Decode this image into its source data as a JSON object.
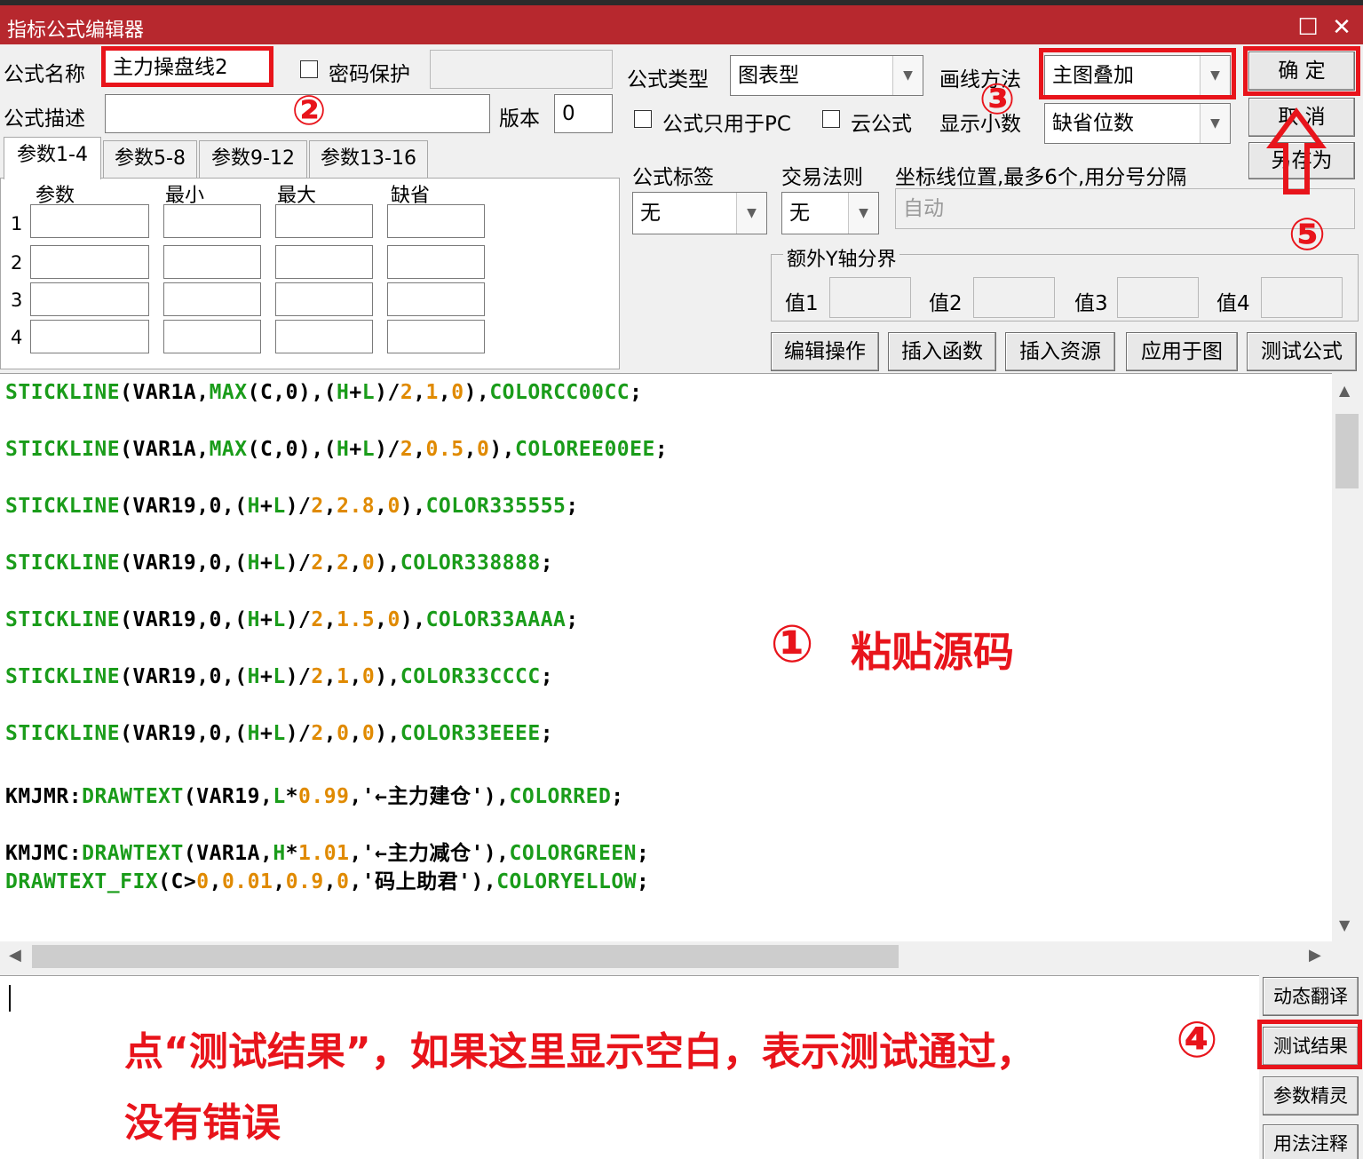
{
  "window": {
    "title": "指标公式编辑器",
    "maximize_glyph": "☐",
    "close_glyph": "✕"
  },
  "form": {
    "name_label": "公式名称",
    "name_value": "主力操盘线2",
    "password_label": "密码保护",
    "desc_label": "公式描述",
    "version_label": "版本",
    "version_value": "0",
    "type_label": "公式类型",
    "type_value": "图表型",
    "draw_label": "画线方法",
    "draw_value": "主图叠加",
    "pc_only_label": "公式只用于PC",
    "cloud_label": "云公式",
    "decimal_label": "显示小数",
    "decimal_value": "缺省位数",
    "tag_label": "公式标签",
    "tag_value": "无",
    "trade_label": "交易法则",
    "trade_value": "无",
    "coord_label": "坐标线位置,最多6个,用分号分隔",
    "coord_value": "自动",
    "yaxis_group": "额外Y轴分界",
    "yvals": [
      "值1",
      "值2",
      "值3",
      "值4"
    ]
  },
  "buttons": {
    "ok": "确  定",
    "cancel": "取  消",
    "save_as": "另存为",
    "edit_ops": "编辑操作",
    "insert_func": "插入函数",
    "insert_res": "插入资源",
    "apply": "应用于图",
    "test": "测试公式",
    "dyn_translate": "动态翻译",
    "test_result": "测试结果",
    "param_wizard": "参数精灵",
    "usage_note": "用法注释"
  },
  "tabs": [
    "参数1-4",
    "参数5-8",
    "参数9-12",
    "参数13-16"
  ],
  "params": {
    "headers": [
      "参数",
      "最小",
      "最大",
      "缺省"
    ],
    "rows": [
      "1",
      "2",
      "3",
      "4"
    ]
  },
  "code": [
    [
      [
        "STICKLINE",
        "g"
      ],
      [
        "(VAR1A,",
        "k"
      ],
      [
        "MAX",
        "g"
      ],
      [
        "(C,0),(",
        "k"
      ],
      [
        "H",
        "g"
      ],
      [
        "+",
        "k"
      ],
      [
        "L",
        "g"
      ],
      [
        ")/",
        "k"
      ],
      [
        "2",
        "o"
      ],
      [
        ",",
        "k"
      ],
      [
        "1",
        "o"
      ],
      [
        ",",
        "k"
      ],
      [
        "0",
        "o"
      ],
      [
        "),",
        "k"
      ],
      [
        "COLORCC00CC",
        "g"
      ],
      [
        ";",
        "k"
      ]
    ],
    [
      [
        "STICKLINE",
        "g"
      ],
      [
        "(VAR1A,",
        "k"
      ],
      [
        "MAX",
        "g"
      ],
      [
        "(C,0),(",
        "k"
      ],
      [
        "H",
        "g"
      ],
      [
        "+",
        "k"
      ],
      [
        "L",
        "g"
      ],
      [
        ")/",
        "k"
      ],
      [
        "2",
        "o"
      ],
      [
        ",",
        "k"
      ],
      [
        "0.5",
        "o"
      ],
      [
        ",",
        "k"
      ],
      [
        "0",
        "o"
      ],
      [
        "),",
        "k"
      ],
      [
        "COLOREE00EE",
        "g"
      ],
      [
        ";",
        "k"
      ]
    ],
    [
      [
        "STICKLINE",
        "g"
      ],
      [
        "(VAR19,0,(",
        "k"
      ],
      [
        "H",
        "g"
      ],
      [
        "+",
        "k"
      ],
      [
        "L",
        "g"
      ],
      [
        ")/",
        "k"
      ],
      [
        "2",
        "o"
      ],
      [
        ",",
        "k"
      ],
      [
        "2.8",
        "o"
      ],
      [
        ",",
        "k"
      ],
      [
        "0",
        "o"
      ],
      [
        "),",
        "k"
      ],
      [
        "COLOR335555",
        "g"
      ],
      [
        ";",
        "k"
      ]
    ],
    [
      [
        "STICKLINE",
        "g"
      ],
      [
        "(VAR19,0,(",
        "k"
      ],
      [
        "H",
        "g"
      ],
      [
        "+",
        "k"
      ],
      [
        "L",
        "g"
      ],
      [
        ")/",
        "k"
      ],
      [
        "2",
        "o"
      ],
      [
        ",",
        "k"
      ],
      [
        "2",
        "o"
      ],
      [
        ",",
        "k"
      ],
      [
        "0",
        "o"
      ],
      [
        "),",
        "k"
      ],
      [
        "COLOR338888",
        "g"
      ],
      [
        ";",
        "k"
      ]
    ],
    [
      [
        "STICKLINE",
        "g"
      ],
      [
        "(VAR19,0,(",
        "k"
      ],
      [
        "H",
        "g"
      ],
      [
        "+",
        "k"
      ],
      [
        "L",
        "g"
      ],
      [
        ")/",
        "k"
      ],
      [
        "2",
        "o"
      ],
      [
        ",",
        "k"
      ],
      [
        "1.5",
        "o"
      ],
      [
        ",",
        "k"
      ],
      [
        "0",
        "o"
      ],
      [
        "),",
        "k"
      ],
      [
        "COLOR33AAAA",
        "g"
      ],
      [
        ";",
        "k"
      ]
    ],
    [
      [
        "STICKLINE",
        "g"
      ],
      [
        "(VAR19,0,(",
        "k"
      ],
      [
        "H",
        "g"
      ],
      [
        "+",
        "k"
      ],
      [
        "L",
        "g"
      ],
      [
        ")/",
        "k"
      ],
      [
        "2",
        "o"
      ],
      [
        ",",
        "k"
      ],
      [
        "1",
        "o"
      ],
      [
        ",",
        "k"
      ],
      [
        "0",
        "o"
      ],
      [
        "),",
        "k"
      ],
      [
        "COLOR33CCCC",
        "g"
      ],
      [
        ";",
        "k"
      ]
    ],
    [
      [
        "STICKLINE",
        "g"
      ],
      [
        "(VAR19,0,(",
        "k"
      ],
      [
        "H",
        "g"
      ],
      [
        "+",
        "k"
      ],
      [
        "L",
        "g"
      ],
      [
        ")/",
        "k"
      ],
      [
        "2",
        "o"
      ],
      [
        ",",
        "k"
      ],
      [
        "0",
        "o"
      ],
      [
        ",",
        "k"
      ],
      [
        "0",
        "o"
      ],
      [
        "),",
        "k"
      ],
      [
        "COLOR33EEEE",
        "g"
      ],
      [
        ";",
        "k"
      ]
    ],
    [
      [
        "KMJMR:",
        "k"
      ],
      [
        "DRAWTEXT",
        "g"
      ],
      [
        "(VAR19,",
        "k"
      ],
      [
        "L",
        "g"
      ],
      [
        "*",
        "k"
      ],
      [
        "0.99",
        "o"
      ],
      [
        ",'←主力建仓'),",
        "k"
      ],
      [
        "COLORRED",
        "g"
      ],
      [
        ";",
        "k"
      ]
    ],
    [
      [
        "KMJMC:",
        "k"
      ],
      [
        "DRAWTEXT",
        "g"
      ],
      [
        "(VAR1A,",
        "k"
      ],
      [
        "H",
        "g"
      ],
      [
        "*",
        "k"
      ],
      [
        "1.01",
        "o"
      ],
      [
        ",'←主力减仓'),",
        "k"
      ],
      [
        "COLORGREEN",
        "g"
      ],
      [
        ";",
        "k"
      ]
    ],
    [
      [
        "DRAWTEXT_FIX",
        "g"
      ],
      [
        "(C>",
        "k"
      ],
      [
        "0",
        "o"
      ],
      [
        ",",
        "k"
      ],
      [
        "0.01",
        "o"
      ],
      [
        ",",
        "k"
      ],
      [
        "0.9",
        "o"
      ],
      [
        ",",
        "k"
      ],
      [
        "0",
        "o"
      ],
      [
        ",'码上助君'),",
        "k"
      ],
      [
        "COLORYELLOW",
        "g"
      ],
      [
        ";",
        "k"
      ]
    ]
  ],
  "annotations": {
    "step1": "①",
    "step1_text": "粘贴源码",
    "step2": "②",
    "step3": "③",
    "step4": "④",
    "step5": "⑤",
    "note_line1": "点“测试结果”，如果这里显示空白，表示测试通过，",
    "note_line2": "没有错误"
  },
  "colors": {
    "title_bar": "#b7282e",
    "annotation_red": "#e8141b",
    "code_green": "#1a9c1a",
    "code_orange": "#e08a00"
  }
}
